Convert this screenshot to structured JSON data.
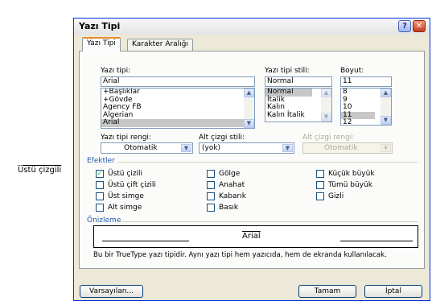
{
  "outside_label": "Üstü çizgili",
  "window": {
    "title": "Yazı Tipi",
    "help_symbol": "?",
    "close_symbol": "✕"
  },
  "tabs": [
    {
      "label": "Yazı Tipi",
      "active": true
    },
    {
      "label": "Karakter Aralığı",
      "active": false
    }
  ],
  "font": {
    "label": "Yazı tipi:",
    "value": "Arial",
    "items": [
      "+Başlıklar",
      "+Gövde",
      "Agency FB",
      "Algerian",
      "Arial"
    ],
    "selected": "Arial"
  },
  "style": {
    "label": "Yazı tipi stili:",
    "value": "Normal",
    "items": [
      "Normal",
      "İtalik",
      "Kalın",
      "Kalın İtalik"
    ],
    "selected": "Normal"
  },
  "size": {
    "label": "Boyut:",
    "value": "11",
    "items": [
      "8",
      "9",
      "10",
      "11",
      "12"
    ],
    "selected": "11"
  },
  "font_color": {
    "label": "Yazı tipi rengi:",
    "value": "Otomatik"
  },
  "underline_style": {
    "label": "Alt çizgi stili:",
    "value": "(yok)"
  },
  "underline_color": {
    "label": "Alt çizgi rengi:",
    "value": "Otomatik"
  },
  "effects": {
    "header": "Efektler",
    "items": {
      "ustu_cizili": {
        "label": "Üstü çizili",
        "checked": true
      },
      "ustu_cift_cizili": {
        "label": "Üstü çift çizili",
        "checked": false
      },
      "ust_simge": {
        "label": "Üst simge",
        "checked": false
      },
      "alt_simge": {
        "label": "Alt simge",
        "checked": false
      },
      "golge": {
        "label": "Gölge",
        "checked": false
      },
      "anahat": {
        "label": "Anahat",
        "checked": false
      },
      "kabarik": {
        "label": "Kabarık",
        "checked": false
      },
      "basik": {
        "label": "Basık",
        "checked": false
      },
      "kucuk_buyuk": {
        "label": "Küçük büyük",
        "checked": false
      },
      "tumu_buyuk": {
        "label": "Tümü büyük",
        "checked": false
      },
      "gizli": {
        "label": "Gizli",
        "checked": false
      }
    }
  },
  "preview": {
    "header": "Önizleme",
    "sample": "Arial",
    "note": "Bu bir TrueType yazı tipidir. Aynı yazı tipi hem yazıcıda, hem de ekranda kullanılacak."
  },
  "buttons": {
    "default": "Varsayılan...",
    "ok": "Tamam",
    "cancel": "İptal"
  },
  "colors": {
    "title_border": "#0831d9",
    "group_header": "#1d5aab",
    "check_mark": "#21a121",
    "close_button": "#c6391b"
  }
}
